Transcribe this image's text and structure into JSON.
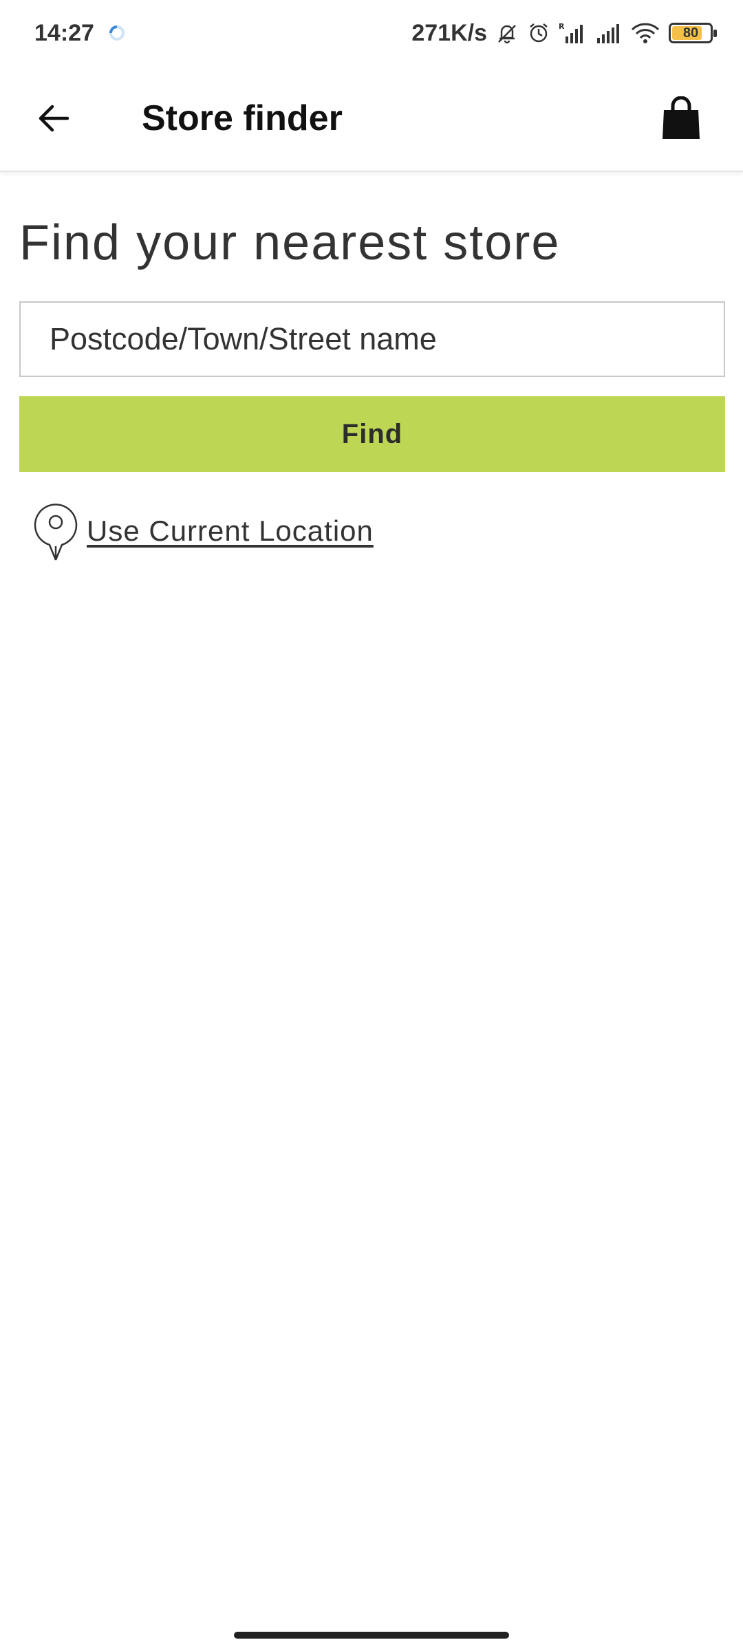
{
  "status_bar": {
    "time": "14:27",
    "net_speed": "271K/s",
    "battery_level": "80",
    "battery_fraction": 0.8,
    "icons": [
      "loading-icon",
      "mute-bell-icon",
      "alarm-icon",
      "signal-r-icon",
      "signal-icon",
      "wifi-icon",
      "battery-icon"
    ]
  },
  "app_bar": {
    "back_icon": "arrow-left-icon",
    "title": "Store finder",
    "bag_icon": "shopping-bag-icon"
  },
  "main": {
    "heading": "Find your nearest store",
    "search": {
      "placeholder": "Postcode/Town/Street name",
      "value": ""
    },
    "find_label": "Find",
    "location_icon": "map-pin-icon",
    "location_label": "Use Current Location"
  },
  "colors": {
    "accent": "#bdd755",
    "battery": "#f5c04a"
  }
}
